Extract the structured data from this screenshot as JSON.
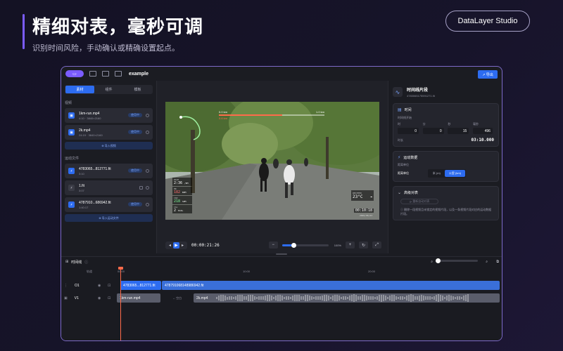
{
  "hero": {
    "title": "精细对表，毫秒可调",
    "subtitle": "识别时间风险，手动确认或精确设置起点。",
    "brand": "DataLayer Studio"
  },
  "toolbar": {
    "project_name": "example",
    "export_label": "↗ 导出"
  },
  "left_panel": {
    "tabs": [
      "素材",
      "组件",
      "模板"
    ],
    "active_tab": 0,
    "video_section": "视频",
    "videos": [
      {
        "name": "1km-run.mp4",
        "meta": "4:10 · 3840×2160",
        "badge": "使用中"
      },
      {
        "name": "2k.mp4",
        "meta": "24:19 · 3840×2160",
        "badge": "使用中"
      }
    ],
    "import_video": "导入视频",
    "activity_section": "运动文件",
    "activities": [
      {
        "name": "4783065...812771.fit",
        "meta": "3:10",
        "badge": "使用中",
        "icon": "blue"
      },
      {
        "name": "1.fit",
        "meta": "3:07",
        "badge": "",
        "icon": "gray"
      },
      {
        "name": "4787910...686942.fit",
        "meta": "1:40:17",
        "badge": "使用中",
        "icon": "blue"
      }
    ],
    "import_activity": "导入运动文件"
  },
  "video": {
    "distance_start": "0.0 km",
    "distance_end": "1.0 km",
    "distance_cur": "0.6 km",
    "pace_label": "PACE",
    "pace_value": "2:36",
    "pace_unit": "/KM",
    "hr_label": "HR",
    "hr_value": "182",
    "hr_unit": "BPM",
    "cad_label": "CAD",
    "cad_value": "218",
    "cad_unit": "SPM",
    "cal_label": "CAL",
    "cal_value": "2",
    "cal_unit": "KCAL",
    "weather_label": "WEATHER",
    "temp": "23°C",
    "clock": "00:10:18",
    "date": "2026/06/23"
  },
  "playbar": {
    "timecode": "00:00:21:26",
    "zoom_pct": "100%",
    "zoom_level": 0.25
  },
  "inspector": {
    "title": "时间线片段",
    "subtitle": "4783065175591271.fit",
    "time_card": {
      "title": "时间",
      "start_label": "时间线开始",
      "fields": [
        {
          "label": "时",
          "value": "0"
        },
        {
          "label": "分",
          "value": "0"
        },
        {
          "label": "秒",
          "value": "15"
        },
        {
          "label": "毫秒",
          "value": "496"
        }
      ],
      "duration_label": "时长",
      "duration_value": "03:10.000"
    },
    "activity_card": {
      "title": "运动数据",
      "unit_label": "距离单位",
      "unit_row_label": "距离单位",
      "units": [
        "米 (m)",
        "公里 (km)"
      ],
      "active_unit": 1
    },
    "advanced_card": {
      "title": "高级对表",
      "button": "重新自动对表",
      "hint": "删除一段视频且未锁定的视频片段，以及一条视频片段对应的运动数据片段。"
    }
  },
  "timeline": {
    "title": "时间线",
    "col_header": "轨道",
    "ticks": [
      "00:00",
      "10:00",
      "20:00"
    ],
    "tracks": [
      {
        "name": "O1",
        "clips": [
          "4783065...812771.fit",
          "478791068148986942.fit"
        ]
      },
      {
        "name": "V1",
        "clips": [
          "1km-run.mp4",
          "2k.mp4"
        ],
        "gap_label": "↔ 空白"
      }
    ]
  }
}
